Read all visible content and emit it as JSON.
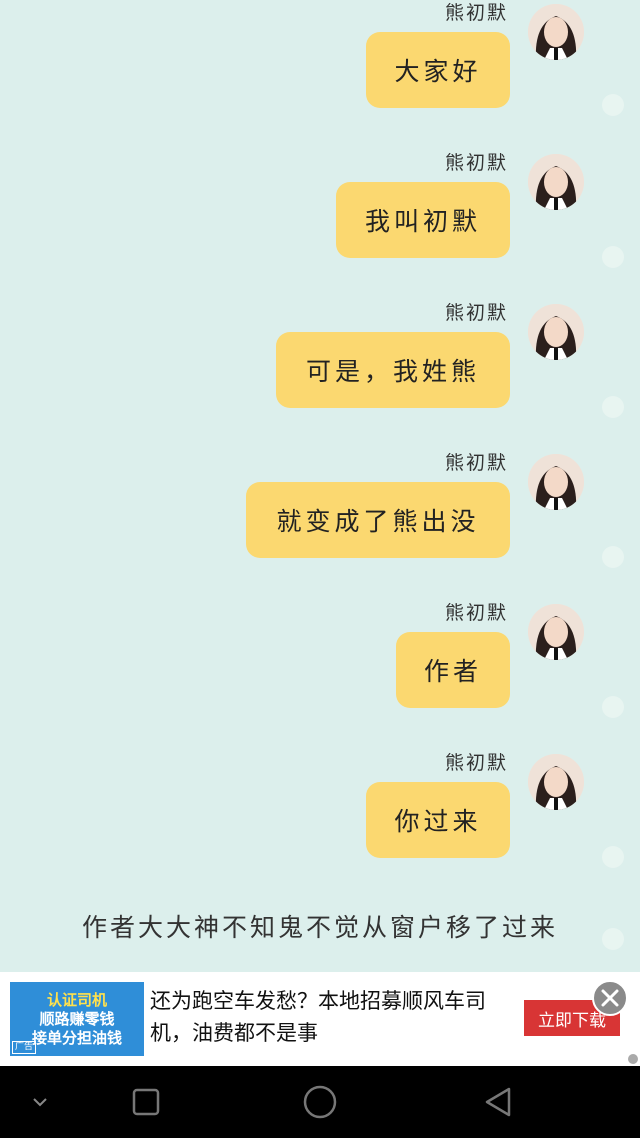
{
  "messages": [
    {
      "name": "熊初默",
      "text": "大家好"
    },
    {
      "name": "熊初默",
      "text": "我叫初默"
    },
    {
      "name": "熊初默",
      "text": "可是，我姓熊"
    },
    {
      "name": "熊初默",
      "text": "就变成了熊出没"
    },
    {
      "name": "熊初默",
      "text": "作者"
    },
    {
      "name": "熊初默",
      "text": "你过来"
    }
  ],
  "caption": "作者大大神不知鬼不觉从窗户移了过来",
  "ad": {
    "image_lines": [
      "认证司机",
      "顺路赚零钱",
      "接单分担油钱"
    ],
    "tag": "广告",
    "text": "还为跑空车发愁？本地招募顺风车司机，油费都不是事",
    "button": "立即下载"
  },
  "colors": {
    "background": "#dcefec",
    "bubble": "#fbd870",
    "ad_button": "#d83535"
  },
  "icons": {
    "nav": [
      "chevron-down-icon",
      "recent-apps-icon",
      "home-icon",
      "back-icon"
    ]
  }
}
